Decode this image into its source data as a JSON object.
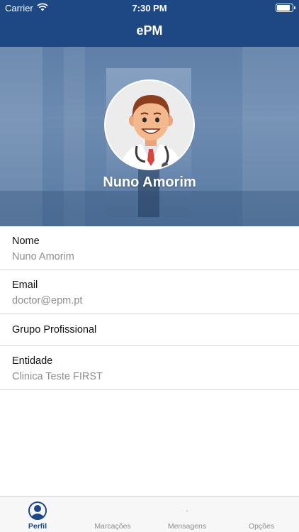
{
  "status_bar": {
    "carrier": "Carrier",
    "time": "7:30 PM"
  },
  "nav": {
    "title": "ePM"
  },
  "profile": {
    "name": "Nuno Amorim"
  },
  "fields": [
    {
      "label": "Nome",
      "value": "Nuno Amorim"
    },
    {
      "label": "Email",
      "value": "doctor@epm.pt"
    },
    {
      "label": "Grupo Profissional",
      "value": ""
    },
    {
      "label": "Entidade",
      "value": "Clinica Teste FIRST"
    }
  ],
  "tabs": [
    {
      "label": "Perfil",
      "icon": "person-circle-icon",
      "active": true
    },
    {
      "label": "Marcações",
      "icon": "calendar-icon",
      "active": false
    },
    {
      "label": "Mensagens",
      "icon": "messages-icon",
      "active": false
    },
    {
      "label": "Opções",
      "icon": "options-icon",
      "active": false
    }
  ],
  "colors": {
    "nav_bar": "#1d4883",
    "tab_active": "#1d4883",
    "tab_inactive": "#8e8e93"
  }
}
